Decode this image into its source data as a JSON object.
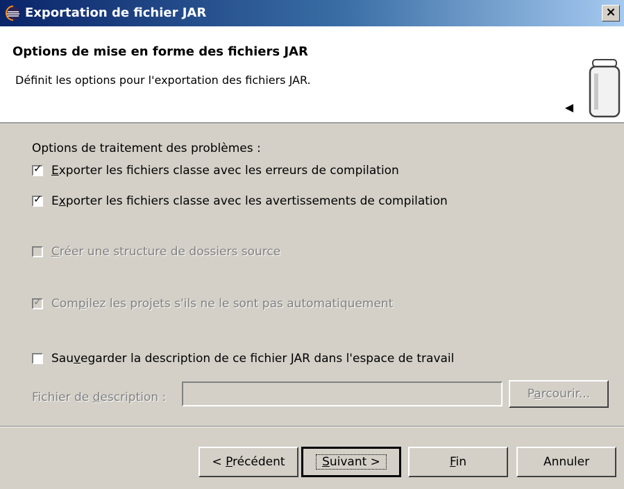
{
  "window": {
    "title": "Exportation de fichier JAR",
    "close_label": "×"
  },
  "banner": {
    "title": "Options de mise en forme des fichiers JAR",
    "description": "Définit les options pour l'exportation des fichiers JAR."
  },
  "options": {
    "section_label": "Options de traitement des problèmes :",
    "export_errors": {
      "pre": "",
      "mnemonic": "E",
      "post": "xporter les fichiers classe avec les erreurs de compilation",
      "checked": true,
      "enabled": true
    },
    "export_warnings": {
      "pre": "E",
      "mnemonic": "x",
      "post": "porter les fichiers classe avec les avertissements de compilation",
      "checked": true,
      "enabled": true
    },
    "create_source_folders": {
      "pre": "",
      "mnemonic": "C",
      "post": "réer une structure de dossiers source",
      "checked": false,
      "enabled": false
    },
    "build_projects": {
      "pre": "Com",
      "mnemonic": "p",
      "post": "ilez les projets s'ils ne le sont pas automatiquement",
      "checked": true,
      "enabled": false
    },
    "save_description": {
      "pre": "Sau",
      "mnemonic": "v",
      "post": "egarder la description de ce fichier JAR dans l'espace de travail",
      "checked": false,
      "enabled": true
    }
  },
  "description_file": {
    "label_pre": "Fichier de ",
    "label_mnemonic": "d",
    "label_post": "escription :",
    "value": "",
    "browse_pre": "P",
    "browse_mnemonic": "a",
    "browse_post": "rcourir..."
  },
  "buttons": {
    "back_pre": "< ",
    "back_mnemonic": "P",
    "back_post": "récédent",
    "next_mnemonic": "S",
    "next_post": "uivant >",
    "finish_mnemonic": "F",
    "finish_post": "in",
    "cancel": "Annuler"
  },
  "icons": {
    "title_icon": "eclipse-icon",
    "banner_icon": "jar-icon",
    "check_mark": "✓"
  },
  "colors": {
    "titlebar_start": "#0a246a",
    "titlebar_end": "#a6caf0",
    "dialog_bg": "#d4d0c8"
  }
}
